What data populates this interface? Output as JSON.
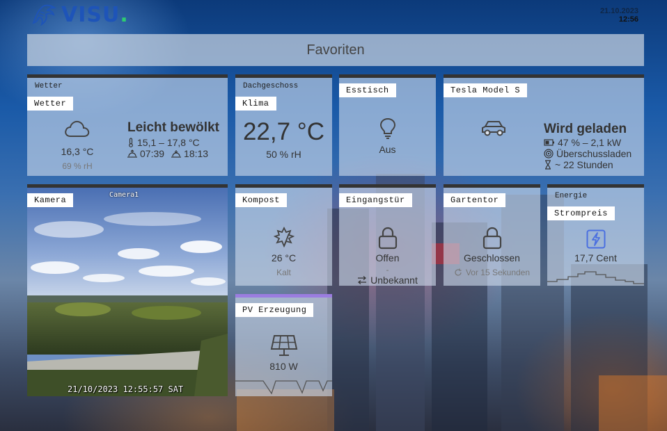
{
  "header": {
    "logo_text": "VISU",
    "logo_dot": ".",
    "date": "21.10.2023",
    "time": "12:56"
  },
  "favorites_title": "Favoriten",
  "tiles": {
    "wetter": {
      "category": "Wetter",
      "label": "Wetter",
      "temp": "16,3 °C",
      "humidity": "69 % rH",
      "condition": "Leicht bewölkt",
      "temp_range": "15,1 – 17,8 °C",
      "sunrise": "07:39",
      "sunset": "18:13"
    },
    "klima": {
      "category": "Dachgeschoss",
      "label": "Klima",
      "temp": "22,7 °C",
      "humidity": "50 % rH"
    },
    "esstisch": {
      "label": "Esstisch",
      "state": "Aus"
    },
    "tesla": {
      "label": "Tesla Model S",
      "status": "Wird geladen",
      "battery": "47 % – 2,1 kW",
      "mode": "Überschussladen",
      "remaining": "~ 22 Stunden"
    },
    "kamera": {
      "label": "Kamera",
      "overlay_name": "Camera1",
      "timestamp": "21/10/2023 12:55:57 SAT"
    },
    "kompost": {
      "label": "Kompost",
      "temp": "26 °C",
      "state": "Kalt"
    },
    "eingangstuer": {
      "label": "Eingangstür",
      "state": "Offen",
      "dash": "-",
      "secondary": "Unbekannt"
    },
    "gartentor": {
      "label": "Gartentor",
      "state": "Geschlossen",
      "updated": "Vor 15 Sekunden"
    },
    "energie": {
      "category": "Energie",
      "label": "Strompreis",
      "price": "17,7 Cent"
    },
    "pv": {
      "label": "PV Erzeugung",
      "power": "810 W"
    }
  },
  "colors": {
    "tile_bg": "#cddaeb",
    "tile_border": "#333333",
    "pv_border": "#9b7de0",
    "logo_blue": "#1e54b8",
    "logo_dot": "#2ecc71",
    "energy_icon": "#4a6fe0"
  },
  "icons": {
    "wetter": "cloud-icon",
    "klima": "",
    "esstisch": "lightbulb-icon",
    "tesla": "car-icon",
    "kompost": "leaf-icon",
    "eingangstuer": "lock-open-icon",
    "gartentor": "lock-closed-icon",
    "energie": "lightning-icon",
    "pv": "solar-panel-icon"
  }
}
